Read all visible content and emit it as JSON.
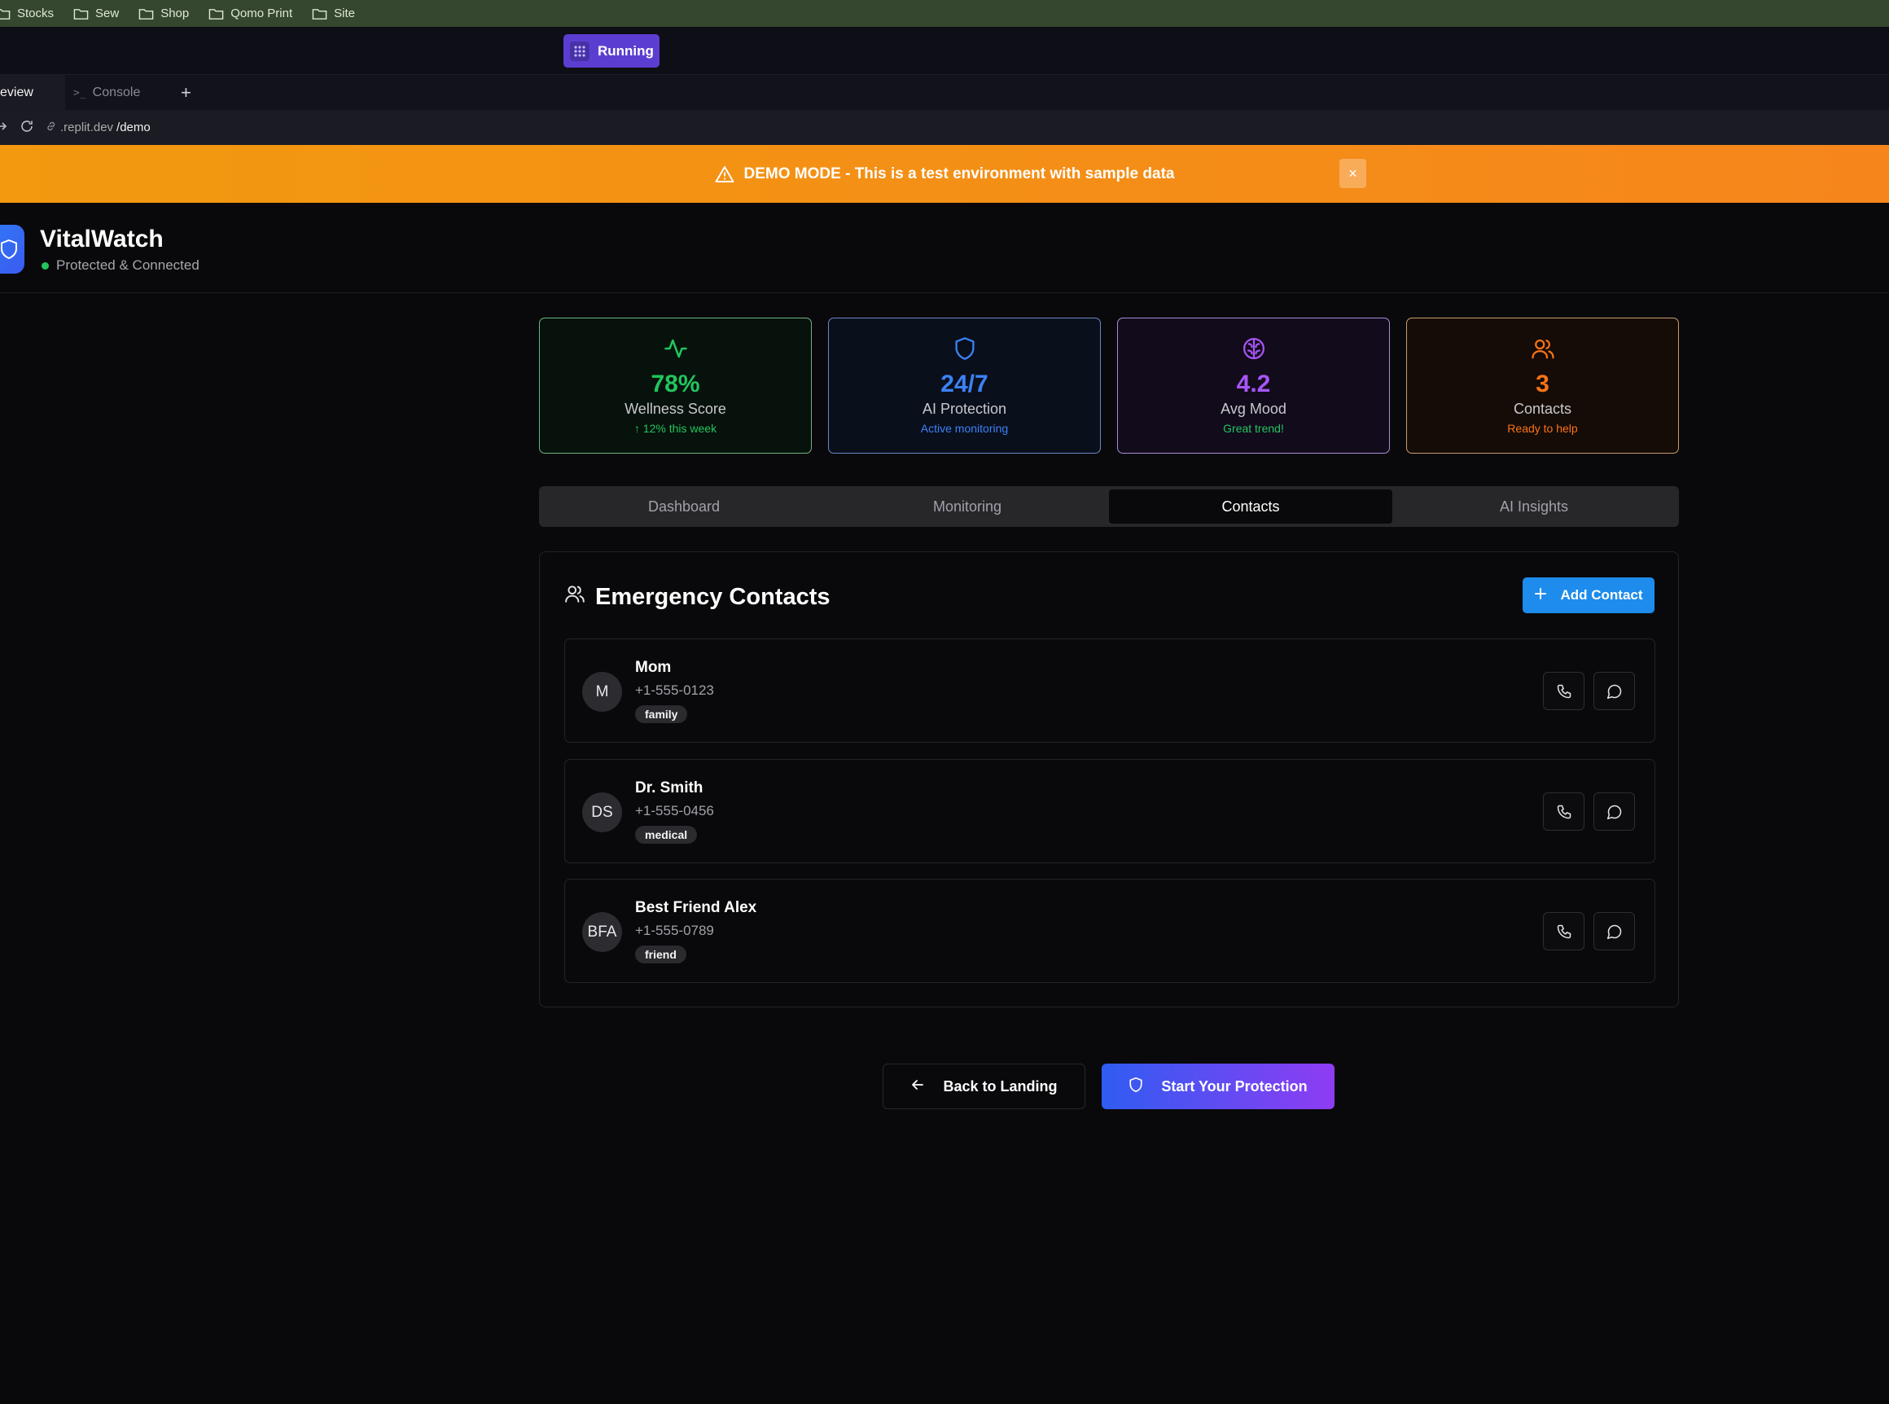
{
  "browser": {
    "bookmarks": [
      "Stocks",
      "Sew",
      "Shop",
      "Qomo Print",
      "Site"
    ],
    "run_label": "Running",
    "tabs": {
      "preview": "eview",
      "console": "Console",
      "add": "+"
    },
    "url_prefix": ".replit.dev",
    "url_path": "/demo"
  },
  "banner": {
    "text": "DEMO MODE - This is a test environment with sample data",
    "close": "×",
    "color": "#f6861c"
  },
  "header": {
    "brand": "VitalWatch",
    "status": "Protected & Connected",
    "status_color": "#22c55e"
  },
  "stats": [
    {
      "value": "78%",
      "label": "Wellness Score",
      "sub": "↑ 12% this week",
      "icon": "activity-icon",
      "color": "#22c55e"
    },
    {
      "value": "24/7",
      "label": "AI Protection",
      "sub": "Active monitoring",
      "icon": "shield-icon",
      "color": "#3b82f6"
    },
    {
      "value": "4.2",
      "label": "Avg Mood",
      "sub": "Great trend!",
      "icon": "brain-icon",
      "color": "#a855f7",
      "sub_color": "#22c55e"
    },
    {
      "value": "3",
      "label": "Contacts",
      "sub": "Ready to help",
      "icon": "users-icon",
      "color": "#f97316"
    }
  ],
  "tabs": [
    "Dashboard",
    "Monitoring",
    "Contacts",
    "AI Insights"
  ],
  "active_tab": "Contacts",
  "contacts_panel": {
    "title": "Emergency Contacts",
    "add_label": "Add Contact",
    "add_color": "#1d8ced"
  },
  "contacts": [
    {
      "initials": "M",
      "name": "Mom",
      "phone": "+1-555-0123",
      "tag": "family"
    },
    {
      "initials": "DS",
      "name": "Dr. Smith",
      "phone": "+1-555-0456",
      "tag": "medical"
    },
    {
      "initials": "BFA",
      "name": "Best Friend Alex",
      "phone": "+1-555-0789",
      "tag": "friend"
    }
  ],
  "actions": {
    "back": "Back to Landing",
    "start": "Start Your Protection"
  }
}
